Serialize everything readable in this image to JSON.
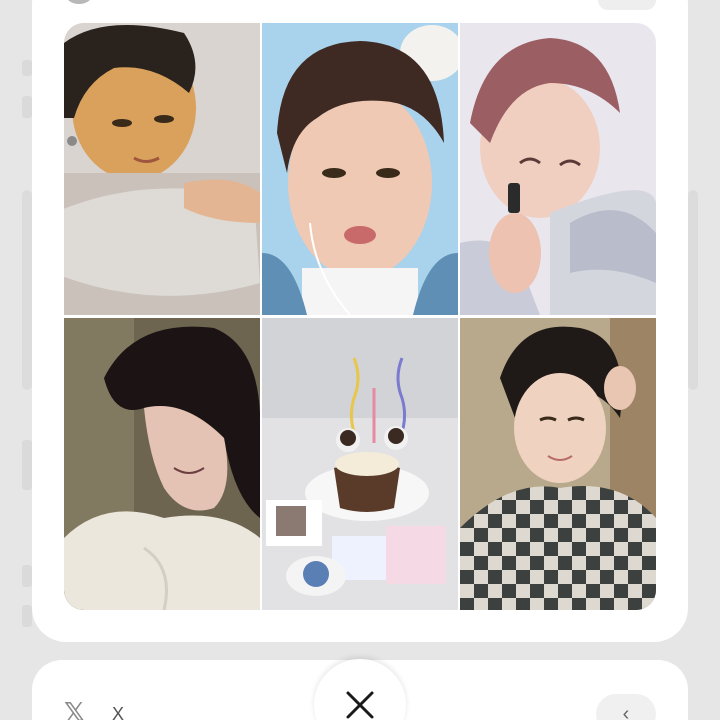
{
  "background_page": {
    "description_hidden": true
  },
  "gallery": {
    "photos": [
      {
        "name": "photo-selfie-pillow",
        "tone": "warm"
      },
      {
        "name": "photo-pout-blue-background",
        "tone": "blue"
      },
      {
        "name": "photo-scarf-hands",
        "tone": "pink"
      },
      {
        "name": "photo-dark-hair-profile",
        "tone": "dark"
      },
      {
        "name": "photo-birthday-cake",
        "tone": "grey"
      },
      {
        "name": "photo-checkered-sweater",
        "tone": "neutral"
      }
    ]
  },
  "share_bar": {
    "network_icon": "x-logo-icon",
    "network_glyph": "𝕏",
    "label": "X",
    "more_label": "‹"
  },
  "close": {
    "icon": "close-icon"
  }
}
